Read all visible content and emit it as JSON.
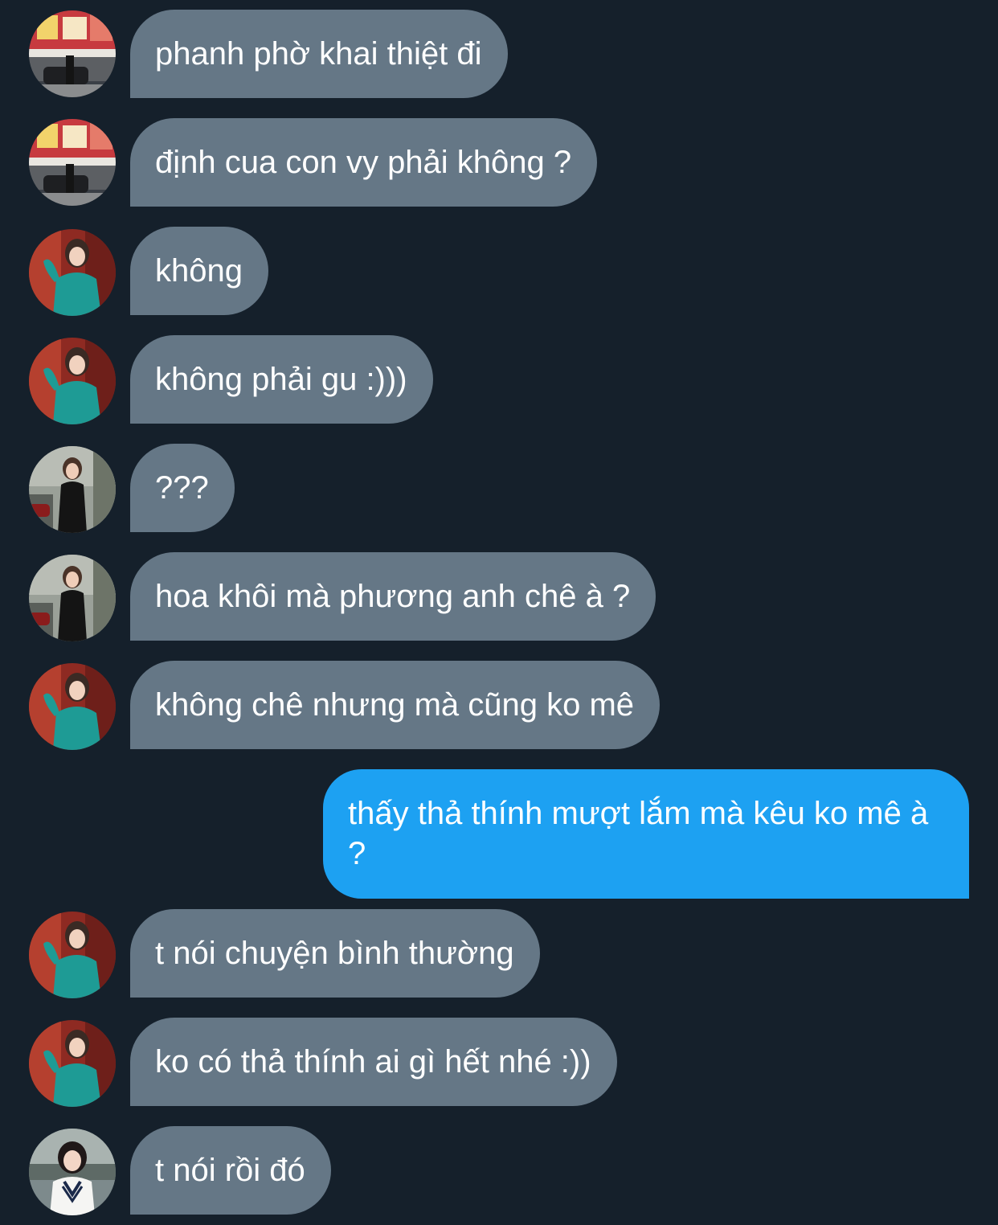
{
  "theme": {
    "background": "#15202b",
    "incoming_bubble": "#657786",
    "outgoing_bubble": "#1da1f2",
    "text": "#ffffff"
  },
  "messages": [
    {
      "id": 1,
      "sender": "them",
      "avatar": "avatar-storefront",
      "text": "phanh phờ khai thiệt đi"
    },
    {
      "id": 2,
      "sender": "them",
      "avatar": "avatar-storefront",
      "text": "định cua con vy phải không ?"
    },
    {
      "id": 3,
      "sender": "them",
      "avatar": "avatar-teal-dress",
      "text": "không"
    },
    {
      "id": 4,
      "sender": "them",
      "avatar": "avatar-teal-dress",
      "text": "không phải gu :)))"
    },
    {
      "id": 5,
      "sender": "them",
      "avatar": "avatar-black-outfit",
      "text": "???"
    },
    {
      "id": 6,
      "sender": "them",
      "avatar": "avatar-black-outfit",
      "text": "hoa khôi mà phương anh chê à ?"
    },
    {
      "id": 7,
      "sender": "them",
      "avatar": "avatar-teal-dress",
      "text": "không chê nhưng mà cũng ko mê"
    },
    {
      "id": 8,
      "sender": "me",
      "text": "thấy thả thính mượt lắm mà kêu ko mê à ?"
    },
    {
      "id": 9,
      "sender": "them",
      "avatar": "avatar-teal-dress",
      "text": "t nói chuyện bình thường"
    },
    {
      "id": 10,
      "sender": "them",
      "avatar": "avatar-teal-dress",
      "text": "ko có thả thính ai gì hết nhé :))"
    },
    {
      "id": 11,
      "sender": "them",
      "avatar": "avatar-white-sweater",
      "text": "t nói rồi đó"
    }
  ]
}
